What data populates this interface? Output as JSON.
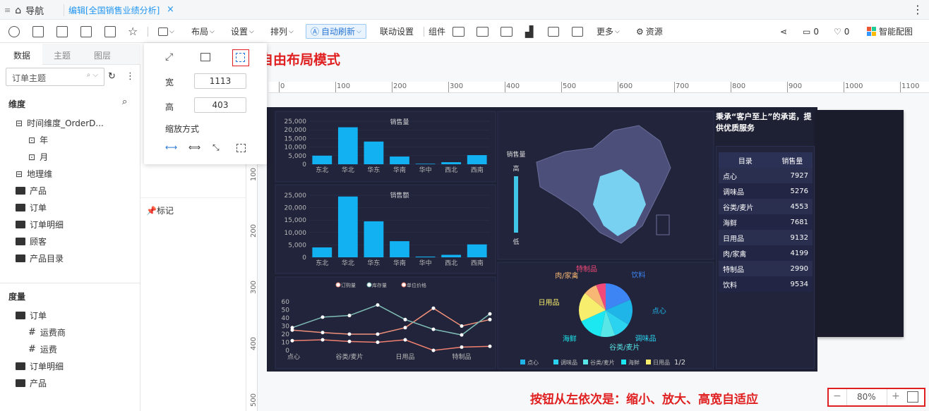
{
  "tabbar": {
    "nav_label": "导航",
    "doc_label": "编辑[全国销售业绩分析]",
    "close": "×",
    "more": "⋮"
  },
  "toolbar": {
    "layout": "布局",
    "settings": "设置",
    "arrange": "排列",
    "auto_refresh": "自动刷新",
    "link_settings": "联动设置",
    "components": "组件",
    "more": "更多",
    "resources": "资源",
    "comment_count": "0",
    "like_count": "0",
    "smart_color": "智能配图"
  },
  "left_panel": {
    "tabs": [
      "数据",
      "主题",
      "图层"
    ],
    "topic_select": "订单主题",
    "dimension_title": "维度",
    "dimensions": [
      "时间维度_OrderD...",
      "年",
      "月",
      "地理维",
      "产品",
      "订单",
      "订单明细",
      "顾客",
      "产品目录"
    ],
    "measure_title": "度量",
    "measures": [
      "订单",
      "运费商",
      "运费",
      "订单明细",
      "产品"
    ]
  },
  "popup": {
    "width_label": "宽",
    "width_value": "1113",
    "height_label": "高",
    "height_value": "403",
    "scale_label": "缩放方式"
  },
  "annotations": {
    "free_layout": "自由布局模式",
    "zoom_hint": "按钮从左依次是：缩小、放大、高宽自适应"
  },
  "marker_label": "标记",
  "ruler": {
    "h": [
      "0",
      "100",
      "200",
      "300",
      "400",
      "500",
      "600",
      "700",
      "800",
      "900",
      "1000",
      "1100"
    ],
    "v": [
      "100",
      "200",
      "300",
      "400",
      "500"
    ]
  },
  "zoom": {
    "minus": "−",
    "value": "80%",
    "plus": "+"
  },
  "chart_data": [
    {
      "type": "bar",
      "title": "销售量",
      "categories": [
        "东北",
        "华北",
        "华东",
        "华南",
        "华中",
        "西北",
        "西南"
      ],
      "values": [
        5000,
        21500,
        13200,
        4500,
        300,
        1200,
        5300
      ],
      "ylim": [
        0,
        25000
      ],
      "yticks": [
        "0",
        "5,000",
        "10,000",
        "15,000",
        "20,000",
        "25,000"
      ]
    },
    {
      "type": "bar",
      "title": "销售额",
      "categories": [
        "东北",
        "华北",
        "华东",
        "华南",
        "华中",
        "西北",
        "西南"
      ],
      "values": [
        4000,
        24500,
        14500,
        6500,
        300,
        1000,
        5200
      ],
      "ylim": [
        0,
        25000
      ],
      "yticks": [
        "0",
        "5,000",
        "10,000",
        "15,000",
        "20,000",
        "25,000"
      ]
    },
    {
      "type": "line",
      "legend": [
        "订购量",
        "库存量",
        "单位价格"
      ],
      "xticks": [
        "点心",
        "谷类/麦片",
        "日用品",
        "特制品"
      ],
      "yticks": [
        "0",
        "10",
        "20",
        "30",
        "40",
        "50",
        "60"
      ],
      "ylim": [
        0,
        60
      ],
      "series": [
        {
          "name": "订购量",
          "color": "#f0907a",
          "values": [
            25,
            22,
            20,
            20,
            28,
            52,
            30,
            38
          ]
        },
        {
          "name": "库存量",
          "color": "#7fbdb6",
          "values": [
            28,
            41,
            43,
            56,
            38,
            26,
            19,
            45
          ]
        },
        {
          "name": "单位价格",
          "color": "#f08070",
          "values": [
            12,
            13,
            11,
            10,
            13,
            0,
            4,
            5
          ]
        }
      ]
    },
    {
      "type": "map",
      "title": "销售量",
      "legend_high": "高",
      "legend_low": "低"
    },
    {
      "type": "pie",
      "legend": [
        "点心",
        "调味品",
        "谷类/麦片",
        "海鲜",
        "日用品"
      ],
      "page": "1/2",
      "labels": [
        "饮料",
        "点心",
        "调味品",
        "谷类/麦片",
        "海鲜",
        "日用品",
        "肉/家禽",
        "特制品"
      ],
      "values": [
        9534,
        7927,
        5276,
        4553,
        7681,
        9132,
        4199,
        2990
      ],
      "colors": [
        "#3d85f5",
        "#1fb5e8",
        "#2cd3f0",
        "#58e6e6",
        "#1be8f0",
        "#f8ee6e",
        "#f8b774",
        "#f0497a"
      ]
    },
    {
      "type": "table",
      "columns": [
        "目录",
        "销售量"
      ],
      "rows": [
        [
          "点心",
          "7927"
        ],
        [
          "调味品",
          "5276"
        ],
        [
          "谷类/麦片",
          "4553"
        ],
        [
          "海鲜",
          "7681"
        ],
        [
          "日用品",
          "9132"
        ],
        [
          "肉/家禽",
          "4199"
        ],
        [
          "特制品",
          "2990"
        ],
        [
          "饮料",
          "9534"
        ]
      ]
    }
  ],
  "text_panel": "秉承“客户至上”的承诺，提供优质服务"
}
